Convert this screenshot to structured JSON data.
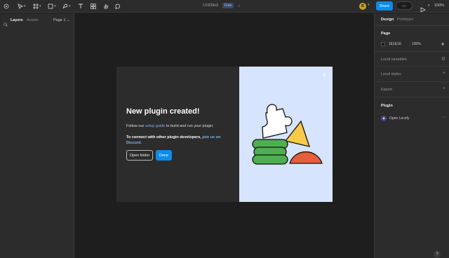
{
  "toolbar": {
    "title": "Untitled",
    "plan_badge": "Free",
    "avatar_initial": "B",
    "share_label": "Share",
    "devmode_label": "</>",
    "zoom": "100%"
  },
  "left_panel": {
    "tabs": [
      "Layers",
      "Assets"
    ],
    "page_selector": "Page 1"
  },
  "right_panel": {
    "tabs": [
      "Design",
      "Prototype"
    ],
    "page_section_title": "Page",
    "page_color": "1E1E1E",
    "page_opacity": "100%",
    "local_variables": "Local variables",
    "local_styles": "Local styles",
    "export": "Export",
    "plugin_section_title": "Plugin",
    "plugin_name": "Open Locofy"
  },
  "modal": {
    "title": "New plugin created!",
    "body_prefix": "Follow our ",
    "body_link": "setup guide",
    "body_suffix": " to build and run your plugin.",
    "connect_prefix": "To connect with other plugin developers, ",
    "connect_link": "join us on Discord.",
    "open_folder_label": "Open folder",
    "done_label": "Done",
    "close_glyph": "✕"
  },
  "help_label": "?",
  "colors": {
    "toolbar_bg": "#2c2c2c",
    "canvas_bg": "#1e1e1e",
    "accent": "#0c8ce9",
    "modal_art_bg": "#d6e4fd",
    "shape_green": "#4caf50",
    "shape_yellow": "#f7c948",
    "shape_red": "#e85d3a"
  }
}
